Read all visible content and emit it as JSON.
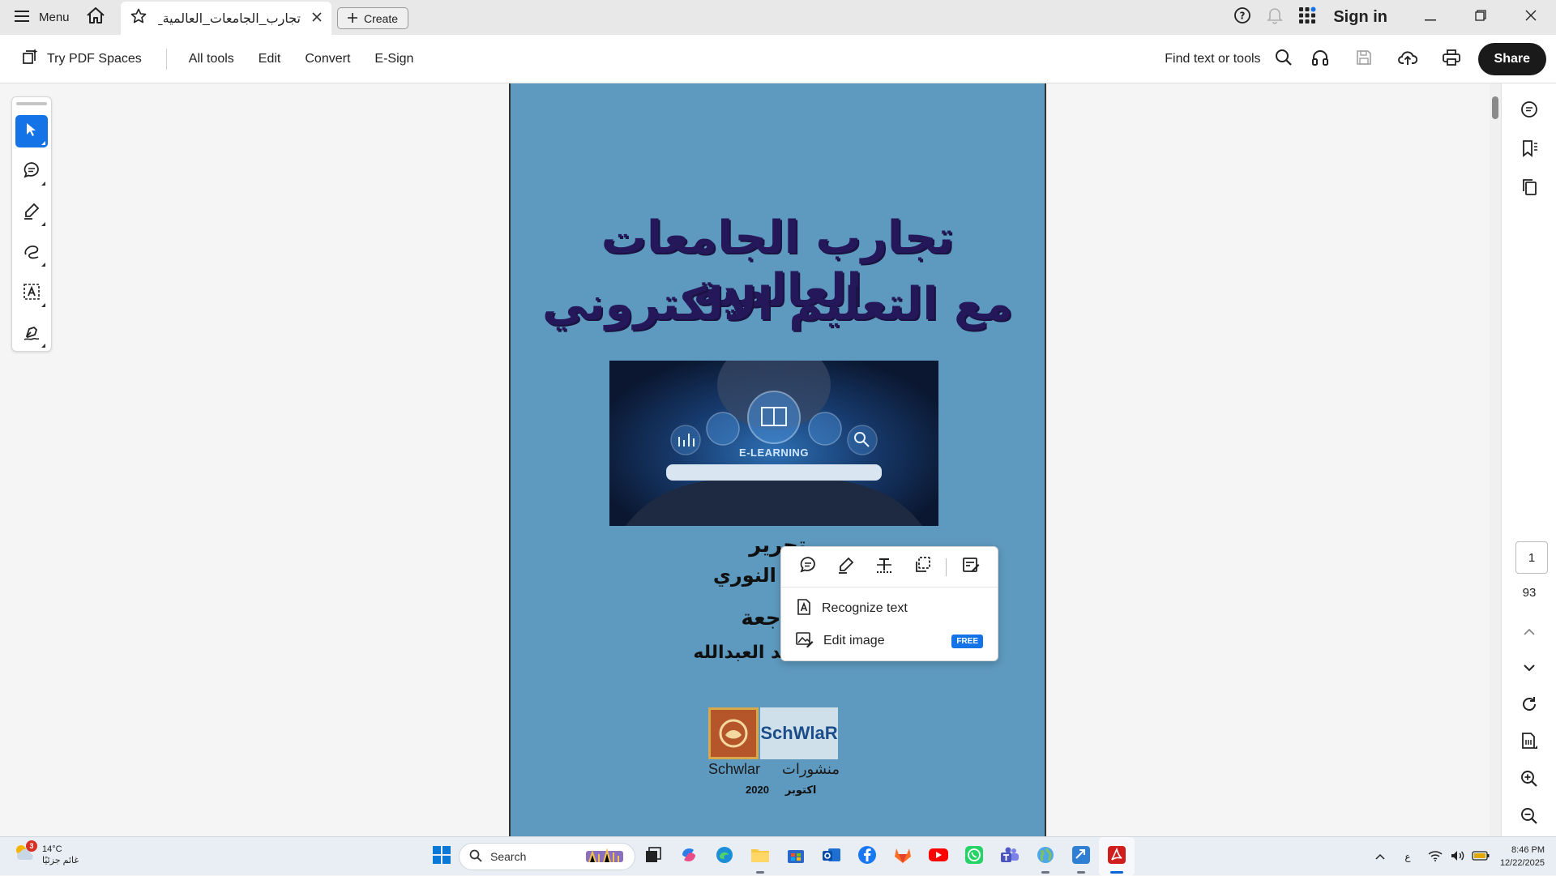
{
  "tabbar": {
    "menu_label": "Menu",
    "tab_title": "تجارب_الجامعات_العالمية_م...",
    "create_label": "Create",
    "signin_label": "Sign in"
  },
  "toolbar": {
    "try_spaces": "Try PDF Spaces",
    "items": [
      "All tools",
      "Edit",
      "Convert",
      "E-Sign"
    ],
    "find_label": "Find text or tools",
    "share_label": "Share"
  },
  "document": {
    "title_line1": "تجارب الجامعات العالمية",
    "title_line2": "مع التعليم الالكتروني",
    "hero_label": "E-LEARNING",
    "editor_heading": "تحرير",
    "editor_name": "سردار النوري",
    "review_heading": "مراجعة",
    "reviewer_name": "عبد الحميد العبدالله",
    "logo_b_text": "SchWlaR",
    "publisher_en": "Schwlar",
    "publisher_ar": "منشورات",
    "month_ar": "اكتوبر",
    "year": "2020"
  },
  "popup": {
    "recognize_label": "Recognize text",
    "edit_image_label": "Edit image",
    "free_badge": "FREE"
  },
  "navigation": {
    "current_page": "1",
    "total_pages": "93"
  },
  "taskbar": {
    "weather_temp": "14°C",
    "weather_desc": "غائم جزئيًا",
    "weather_badge": "3",
    "search_label": "Search",
    "lang_indicator": "ع",
    "time": "8:46 PM",
    "date": "12/22/2025"
  },
  "colors": {
    "accent": "#1473e6",
    "page_bg": "#5e9abf",
    "title_ink": "#24185a"
  }
}
